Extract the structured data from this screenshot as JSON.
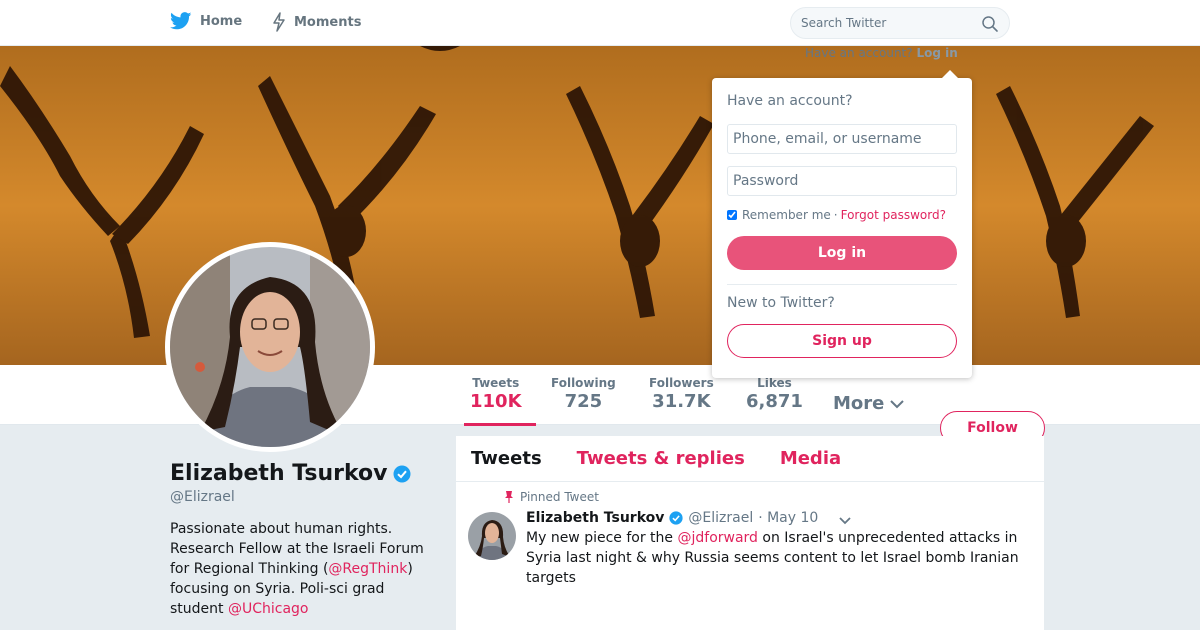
{
  "nav": {
    "home": "Home",
    "moments": "Moments",
    "search_placeholder": "Search Twitter"
  },
  "login_trigger": {
    "text": "Have an account?",
    "link": "Log in"
  },
  "login_dropdown": {
    "heading": "Have an account?",
    "username_placeholder": "Phone, email, or username",
    "password_placeholder": "Password",
    "remember_me": "Remember me",
    "separator": "·",
    "forgot_password": "Forgot password?",
    "login_button": "Log in",
    "new_heading": "New to Twitter?",
    "signup_button": "Sign up"
  },
  "stats": [
    {
      "label": "Tweets",
      "value": "110K"
    },
    {
      "label": "Following",
      "value": "725"
    },
    {
      "label": "Followers",
      "value": "31.7K"
    },
    {
      "label": "Likes",
      "value": "6,871"
    }
  ],
  "more": "More",
  "follow_button": "Follow",
  "profile": {
    "name": "Elizabeth Tsurkov",
    "handle": "@Elizrael",
    "bio": {
      "p1": "Passionate about human rights. Research Fellow at the Israeli Forum for Regional Thinking (",
      "link1": "@RegThink",
      "p2": ") focusing on Syria. Poli-sci grad student ",
      "link2": "@UChicago"
    }
  },
  "tabs": [
    "Tweets",
    "Tweets & replies",
    "Media"
  ],
  "tweet": {
    "pinned_label": "Pinned Tweet",
    "name": "Elizabeth Tsurkov",
    "handle": "@Elizrael",
    "date": "· May 10",
    "text_a": "My new piece for the ",
    "mention": "@jdforward",
    "text_b": " on Israel's unprecedented attacks in Syria last night & why Russia seems content to let Israel bomb Iranian targets"
  },
  "colors": {
    "accent": "#e0245e",
    "brand": "#1da1f2",
    "muted": "#657786",
    "background": "#e6ecf0"
  }
}
